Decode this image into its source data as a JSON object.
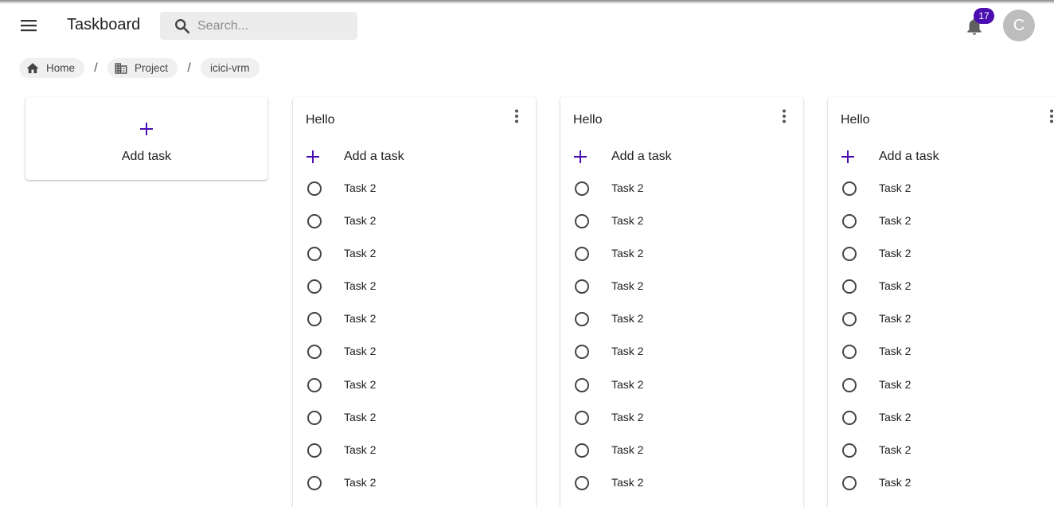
{
  "appbar": {
    "title": "Taskboard",
    "search_placeholder": "Search...",
    "notification_count": "17",
    "avatar_initial": "C"
  },
  "breadcrumb": [
    {
      "label": "Home",
      "icon": "home-icon"
    },
    {
      "label": "Project",
      "icon": "building-icon"
    },
    {
      "label": "icici-vrm",
      "icon": ""
    }
  ],
  "add_card": {
    "label": "Add task"
  },
  "columns": [
    {
      "title": "Hello",
      "add_label": "Add a task",
      "tasks": [
        "Task 2",
        "Task 2",
        "Task 2",
        "Task 2",
        "Task 2",
        "Task 2",
        "Task 2",
        "Task 2",
        "Task 2",
        "Task 2"
      ]
    },
    {
      "title": "Hello",
      "add_label": "Add a task",
      "tasks": [
        "Task 2",
        "Task 2",
        "Task 2",
        "Task 2",
        "Task 2",
        "Task 2",
        "Task 2",
        "Task 2",
        "Task 2",
        "Task 2"
      ]
    },
    {
      "title": "Hello",
      "add_label": "Add a task",
      "tasks": [
        "Task 2",
        "Task 2",
        "Task 2",
        "Task 2",
        "Task 2",
        "Task 2",
        "Task 2",
        "Task 2",
        "Task 2",
        "Task 2"
      ]
    }
  ],
  "colors": {
    "accent": "#4b0eb0",
    "avatar_bg": "#bdbdbd",
    "search_bg": "#ececec"
  }
}
